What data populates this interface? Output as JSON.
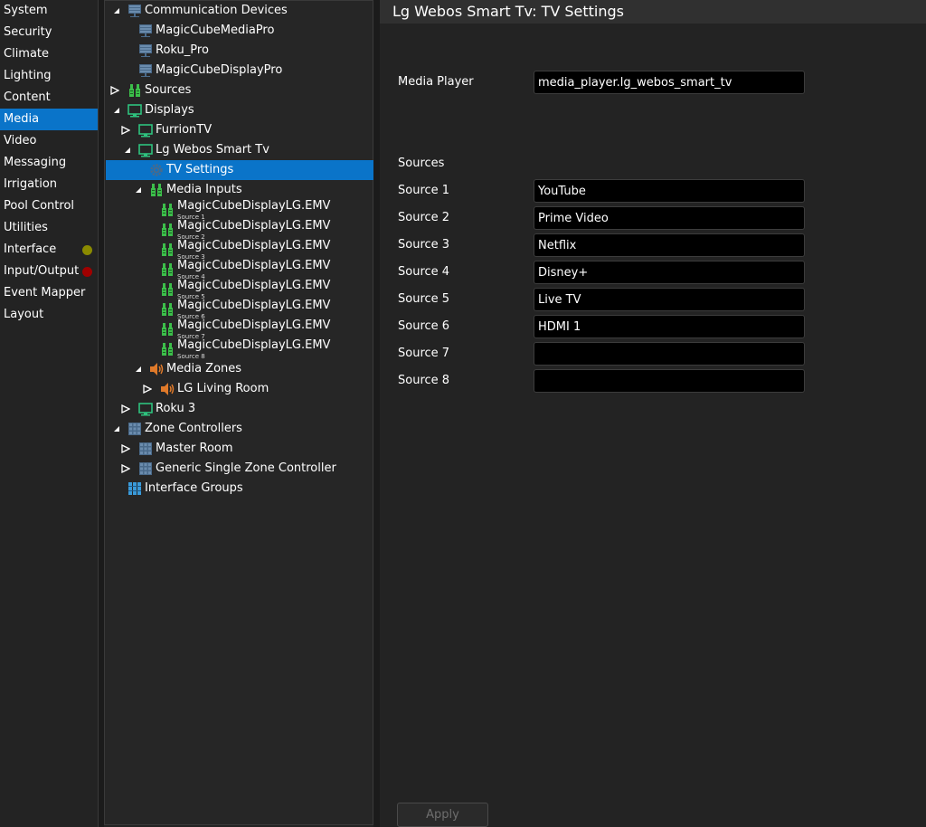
{
  "sidebar": {
    "items": [
      {
        "label": "System"
      },
      {
        "label": "Security"
      },
      {
        "label": "Climate"
      },
      {
        "label": "Lighting"
      },
      {
        "label": "Content"
      },
      {
        "label": "Media",
        "selected": true
      },
      {
        "label": "Video"
      },
      {
        "label": "Messaging"
      },
      {
        "label": "Irrigation"
      },
      {
        "label": "Pool Control"
      },
      {
        "label": "Utilities"
      },
      {
        "label": "Interface",
        "status_color": "#8a8a00"
      },
      {
        "label": "Input/Output",
        "status_color": "#a00000"
      },
      {
        "label": "Event Mapper"
      },
      {
        "label": "Layout"
      }
    ]
  },
  "tree": {
    "communication_devices": "Communication Devices",
    "magiccube_media_pro": "MagicCubeMediaPro",
    "roku_pro": "Roku_Pro",
    "magiccube_display_pro": "MagicCubeDisplayPro",
    "sources": "Sources",
    "displays": "Displays",
    "furrion_tv": "FurrionTV",
    "lg_webos": "Lg Webos Smart Tv",
    "tv_settings": "TV Settings",
    "media_inputs": "Media Inputs",
    "inputs": [
      {
        "label": "MagicCubeDisplayLG.EMV",
        "sub": "Source 1"
      },
      {
        "label": "MagicCubeDisplayLG.EMV",
        "sub": "Source 2"
      },
      {
        "label": "MagicCubeDisplayLG.EMV",
        "sub": "Source 3"
      },
      {
        "label": "MagicCubeDisplayLG.EMV",
        "sub": "Source 4"
      },
      {
        "label": "MagicCubeDisplayLG.EMV",
        "sub": "Source 5"
      },
      {
        "label": "MagicCubeDisplayLG.EMV",
        "sub": "Source 6"
      },
      {
        "label": "MagicCubeDisplayLG.EMV",
        "sub": "Source 7"
      },
      {
        "label": "MagicCubeDisplayLG.EMV",
        "sub": "Source 8"
      }
    ],
    "media_zones": "Media Zones",
    "lg_living_room": "LG Living Room",
    "roku3": "Roku 3",
    "zone_controllers": "Zone Controllers",
    "master_room": "Master Room",
    "generic_single_zone": "Generic Single Zone Controller",
    "interface_groups": "Interface Groups"
  },
  "detail": {
    "title": "Lg Webos Smart Tv: TV Settings",
    "media_player_label": "Media Player",
    "media_player_value": "media_player.lg_webos_smart_tv",
    "sources_heading": "Sources",
    "sources": [
      {
        "label": "Source 1",
        "value": "YouTube"
      },
      {
        "label": "Source 2",
        "value": "Prime Video"
      },
      {
        "label": "Source 3",
        "value": "Netflix"
      },
      {
        "label": "Source 4",
        "value": "Disney+"
      },
      {
        "label": "Source 5",
        "value": "Live TV"
      },
      {
        "label": "Source 6",
        "value": "HDMI 1"
      },
      {
        "label": "Source 7",
        "value": ""
      },
      {
        "label": "Source 8",
        "value": ""
      }
    ],
    "apply_label": "Apply"
  },
  "colors": {
    "selection": "#0a74c9",
    "display_icon": "#2ec27e",
    "media_input_icon": "#3cbf4a",
    "speaker_icon": "#e07a2a",
    "device_icon": "#4a6a8a",
    "interface_groups_icon": "#3a9ad9"
  }
}
